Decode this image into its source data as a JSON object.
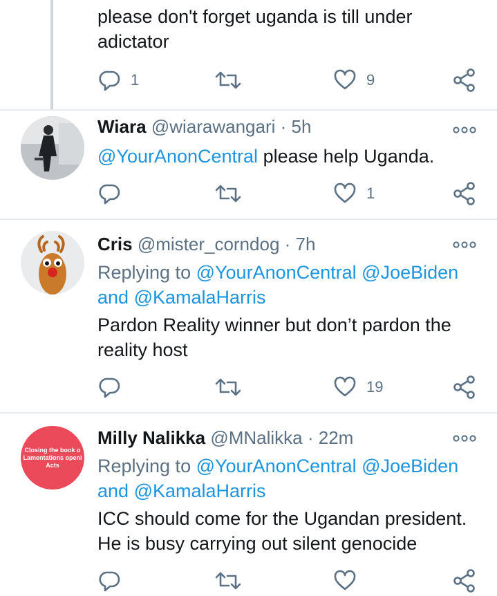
{
  "tweets": [
    {
      "lines": [
        "please don't forget uganda is till under",
        "adictator"
      ],
      "replies": "1",
      "retweets": "",
      "likes": "9"
    },
    {
      "name": "Wiara",
      "handle": "@wiarawangari",
      "sep": "·",
      "time": "5h",
      "mention": "@YourAnonCentral",
      "text": " please help Uganda.",
      "replies": "",
      "retweets": "",
      "likes": "1",
      "avatar_icon": "person-photo-avatar"
    },
    {
      "name": "Cris",
      "handle": "@mister_corndog",
      "sep": "·",
      "time": "7h",
      "replying_prefix": "Replying to ",
      "reply_m1": "@YourAnonCentral",
      "reply_m2": "@JoeBiden",
      "and": "and ",
      "reply_m3": "@KamalaHarris",
      "lines": [
        "Pardon Reality winner but don’t pardon the",
        "reality host"
      ],
      "replies": "",
      "retweets": "",
      "likes": "19",
      "avatar_icon": "reindeer-toy-avatar"
    },
    {
      "name": "Milly Nalikka",
      "handle": "@MNalikka",
      "sep": "·",
      "time": "22m",
      "replying_prefix": "Replying to ",
      "reply_m1": "@YourAnonCentral",
      "reply_m2": "@JoeBiden",
      "and": "and ",
      "reply_m3": "@KamalaHarris",
      "lines": [
        "ICC should come for the Ugandan president.",
        "He is busy carrying out silent genocide"
      ],
      "replies": "",
      "retweets": "",
      "likes": "",
      "avatar_lines": [
        "Closing the book o",
        "Lamentations openi",
        "Acts"
      ],
      "avatar_color": "#ea4a5a"
    }
  ],
  "colors": {
    "link": "#1b95e0",
    "muted": "#5b7083",
    "text": "#14171a",
    "separator": "#e8ebed"
  },
  "icons": [
    "reply-icon",
    "retweet-icon",
    "like-icon",
    "share-icon",
    "more-icon"
  ]
}
